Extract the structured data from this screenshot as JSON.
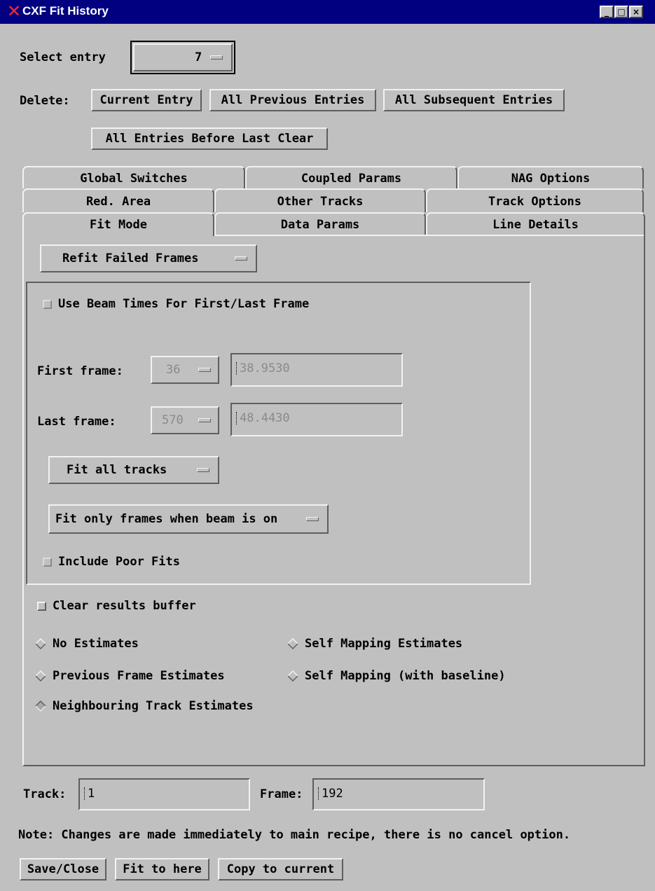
{
  "window": {
    "title": "CXF Fit History",
    "minimize_glyph": "_",
    "maximize_glyph": "□",
    "close_glyph": "×",
    "app_icon": "x-close-icon",
    "colors": {
      "titlebar": "#000080",
      "background": "#c0c0c0",
      "icon": "#ff2a2a"
    }
  },
  "select_entry": {
    "label": "Select entry",
    "value": "7"
  },
  "delete": {
    "label": "Delete:",
    "buttons": [
      "Current Entry",
      "All Previous Entries",
      "All Subsequent Entries",
      "All Entries Before Last Clear"
    ]
  },
  "tabs": {
    "row1": [
      "Global Switches",
      "Coupled Params",
      "NAG Options"
    ],
    "row2": [
      "Red. Area",
      "Other Tracks",
      "Track Options"
    ],
    "row3": [
      "Fit Mode",
      "Data Params",
      "Line Details"
    ],
    "active": "Fit Mode"
  },
  "fit_mode": {
    "refit_option": "Refit Failed Frames",
    "use_beam_times": {
      "label": "Use Beam Times For First/Last Frame",
      "checked": false,
      "enabled": false
    },
    "first_frame": {
      "label": "First frame:",
      "option": "36",
      "value": "38.9530"
    },
    "last_frame": {
      "label": "Last frame:",
      "option": "570",
      "value": "48.4430"
    },
    "tracks_option": "Fit all tracks",
    "beam_option": "Fit only frames when beam is on",
    "include_poor_fits": {
      "label": "Include Poor Fits",
      "checked": false,
      "enabled": false
    },
    "clear_buffer": {
      "label": "Clear results buffer",
      "checked": false
    },
    "estimates": {
      "options": [
        "No Estimates",
        "Self Mapping Estimates",
        "Previous Frame Estimates",
        "Self Mapping (with baseline)",
        "Neighbouring Track Estimates"
      ],
      "selected": "Neighbouring Track Estimates"
    }
  },
  "bottom": {
    "track_label": "Track:",
    "track_value": "1",
    "frame_label": "Frame:",
    "frame_value": "192",
    "note": "Note: Changes are made immediately to main recipe, there is no cancel option.",
    "buttons": [
      "Save/Close",
      "Fit to here",
      "Copy to current"
    ]
  }
}
